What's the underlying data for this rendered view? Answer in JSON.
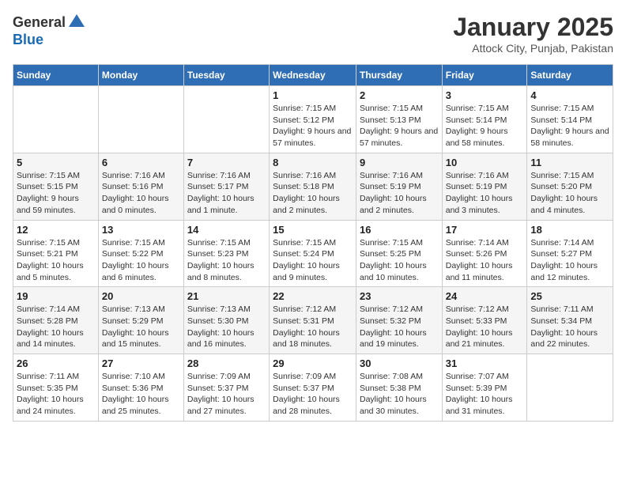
{
  "header": {
    "logo_general": "General",
    "logo_blue": "Blue",
    "title": "January 2025",
    "subtitle": "Attock City, Punjab, Pakistan"
  },
  "weekdays": [
    "Sunday",
    "Monday",
    "Tuesday",
    "Wednesday",
    "Thursday",
    "Friday",
    "Saturday"
  ],
  "weeks": [
    [
      {
        "day": "",
        "sunrise": "",
        "sunset": "",
        "daylight": ""
      },
      {
        "day": "",
        "sunrise": "",
        "sunset": "",
        "daylight": ""
      },
      {
        "day": "",
        "sunrise": "",
        "sunset": "",
        "daylight": ""
      },
      {
        "day": "1",
        "sunrise": "Sunrise: 7:15 AM",
        "sunset": "Sunset: 5:12 PM",
        "daylight": "Daylight: 9 hours and 57 minutes."
      },
      {
        "day": "2",
        "sunrise": "Sunrise: 7:15 AM",
        "sunset": "Sunset: 5:13 PM",
        "daylight": "Daylight: 9 hours and 57 minutes."
      },
      {
        "day": "3",
        "sunrise": "Sunrise: 7:15 AM",
        "sunset": "Sunset: 5:14 PM",
        "daylight": "Daylight: 9 hours and 58 minutes."
      },
      {
        "day": "4",
        "sunrise": "Sunrise: 7:15 AM",
        "sunset": "Sunset: 5:14 PM",
        "daylight": "Daylight: 9 hours and 58 minutes."
      }
    ],
    [
      {
        "day": "5",
        "sunrise": "Sunrise: 7:15 AM",
        "sunset": "Sunset: 5:15 PM",
        "daylight": "Daylight: 9 hours and 59 minutes."
      },
      {
        "day": "6",
        "sunrise": "Sunrise: 7:16 AM",
        "sunset": "Sunset: 5:16 PM",
        "daylight": "Daylight: 10 hours and 0 minutes."
      },
      {
        "day": "7",
        "sunrise": "Sunrise: 7:16 AM",
        "sunset": "Sunset: 5:17 PM",
        "daylight": "Daylight: 10 hours and 1 minute."
      },
      {
        "day": "8",
        "sunrise": "Sunrise: 7:16 AM",
        "sunset": "Sunset: 5:18 PM",
        "daylight": "Daylight: 10 hours and 2 minutes."
      },
      {
        "day": "9",
        "sunrise": "Sunrise: 7:16 AM",
        "sunset": "Sunset: 5:19 PM",
        "daylight": "Daylight: 10 hours and 2 minutes."
      },
      {
        "day": "10",
        "sunrise": "Sunrise: 7:16 AM",
        "sunset": "Sunset: 5:19 PM",
        "daylight": "Daylight: 10 hours and 3 minutes."
      },
      {
        "day": "11",
        "sunrise": "Sunrise: 7:15 AM",
        "sunset": "Sunset: 5:20 PM",
        "daylight": "Daylight: 10 hours and 4 minutes."
      }
    ],
    [
      {
        "day": "12",
        "sunrise": "Sunrise: 7:15 AM",
        "sunset": "Sunset: 5:21 PM",
        "daylight": "Daylight: 10 hours and 5 minutes."
      },
      {
        "day": "13",
        "sunrise": "Sunrise: 7:15 AM",
        "sunset": "Sunset: 5:22 PM",
        "daylight": "Daylight: 10 hours and 6 minutes."
      },
      {
        "day": "14",
        "sunrise": "Sunrise: 7:15 AM",
        "sunset": "Sunset: 5:23 PM",
        "daylight": "Daylight: 10 hours and 8 minutes."
      },
      {
        "day": "15",
        "sunrise": "Sunrise: 7:15 AM",
        "sunset": "Sunset: 5:24 PM",
        "daylight": "Daylight: 10 hours and 9 minutes."
      },
      {
        "day": "16",
        "sunrise": "Sunrise: 7:15 AM",
        "sunset": "Sunset: 5:25 PM",
        "daylight": "Daylight: 10 hours and 10 minutes."
      },
      {
        "day": "17",
        "sunrise": "Sunrise: 7:14 AM",
        "sunset": "Sunset: 5:26 PM",
        "daylight": "Daylight: 10 hours and 11 minutes."
      },
      {
        "day": "18",
        "sunrise": "Sunrise: 7:14 AM",
        "sunset": "Sunset: 5:27 PM",
        "daylight": "Daylight: 10 hours and 12 minutes."
      }
    ],
    [
      {
        "day": "19",
        "sunrise": "Sunrise: 7:14 AM",
        "sunset": "Sunset: 5:28 PM",
        "daylight": "Daylight: 10 hours and 14 minutes."
      },
      {
        "day": "20",
        "sunrise": "Sunrise: 7:13 AM",
        "sunset": "Sunset: 5:29 PM",
        "daylight": "Daylight: 10 hours and 15 minutes."
      },
      {
        "day": "21",
        "sunrise": "Sunrise: 7:13 AM",
        "sunset": "Sunset: 5:30 PM",
        "daylight": "Daylight: 10 hours and 16 minutes."
      },
      {
        "day": "22",
        "sunrise": "Sunrise: 7:12 AM",
        "sunset": "Sunset: 5:31 PM",
        "daylight": "Daylight: 10 hours and 18 minutes."
      },
      {
        "day": "23",
        "sunrise": "Sunrise: 7:12 AM",
        "sunset": "Sunset: 5:32 PM",
        "daylight": "Daylight: 10 hours and 19 minutes."
      },
      {
        "day": "24",
        "sunrise": "Sunrise: 7:12 AM",
        "sunset": "Sunset: 5:33 PM",
        "daylight": "Daylight: 10 hours and 21 minutes."
      },
      {
        "day": "25",
        "sunrise": "Sunrise: 7:11 AM",
        "sunset": "Sunset: 5:34 PM",
        "daylight": "Daylight: 10 hours and 22 minutes."
      }
    ],
    [
      {
        "day": "26",
        "sunrise": "Sunrise: 7:11 AM",
        "sunset": "Sunset: 5:35 PM",
        "daylight": "Daylight: 10 hours and 24 minutes."
      },
      {
        "day": "27",
        "sunrise": "Sunrise: 7:10 AM",
        "sunset": "Sunset: 5:36 PM",
        "daylight": "Daylight: 10 hours and 25 minutes."
      },
      {
        "day": "28",
        "sunrise": "Sunrise: 7:09 AM",
        "sunset": "Sunset: 5:37 PM",
        "daylight": "Daylight: 10 hours and 27 minutes."
      },
      {
        "day": "29",
        "sunrise": "Sunrise: 7:09 AM",
        "sunset": "Sunset: 5:37 PM",
        "daylight": "Daylight: 10 hours and 28 minutes."
      },
      {
        "day": "30",
        "sunrise": "Sunrise: 7:08 AM",
        "sunset": "Sunset: 5:38 PM",
        "daylight": "Daylight: 10 hours and 30 minutes."
      },
      {
        "day": "31",
        "sunrise": "Sunrise: 7:07 AM",
        "sunset": "Sunset: 5:39 PM",
        "daylight": "Daylight: 10 hours and 31 minutes."
      },
      {
        "day": "",
        "sunrise": "",
        "sunset": "",
        "daylight": ""
      }
    ]
  ]
}
